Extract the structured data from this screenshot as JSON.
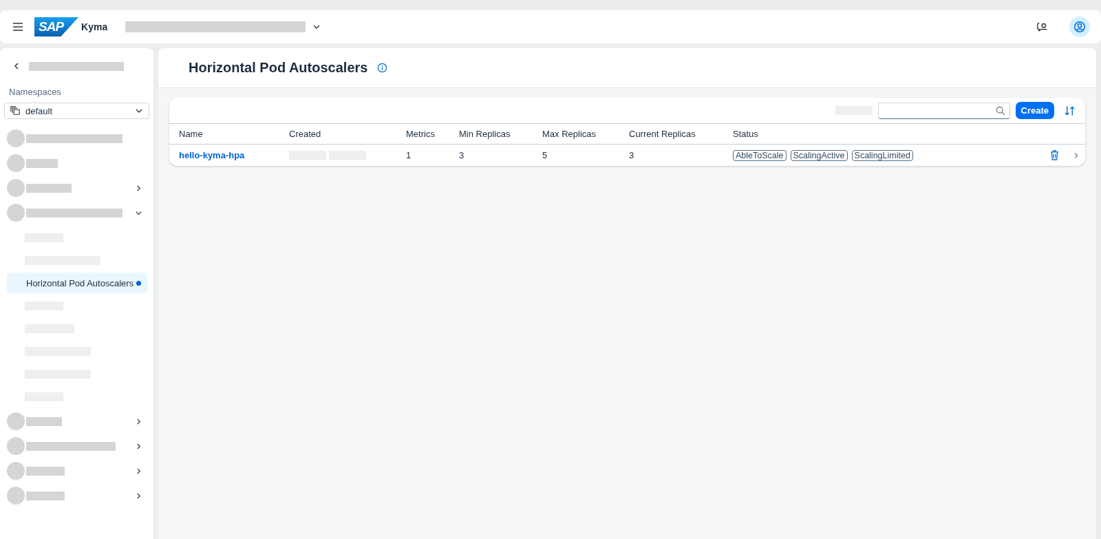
{
  "header": {
    "logo": "SAP",
    "product": "Kyma"
  },
  "sidebar": {
    "namespaces_label": "Namespaces",
    "namespace": "default",
    "items": [
      {
        "kind": "redacted"
      },
      {
        "kind": "redacted"
      },
      {
        "kind": "redacted",
        "expanded": false
      },
      {
        "kind": "redacted",
        "expanded": true,
        "children": [
          {
            "kind": "redacted",
            "selected": false
          },
          {
            "kind": "redacted",
            "selected": false
          },
          {
            "kind": "label",
            "label": "Horizontal Pod Autoscalers",
            "selected": true
          },
          {
            "kind": "redacted",
            "selected": false
          },
          {
            "kind": "redacted",
            "selected": false
          },
          {
            "kind": "redacted",
            "selected": false
          },
          {
            "kind": "redacted",
            "selected": false
          },
          {
            "kind": "redacted",
            "selected": false
          }
        ]
      },
      {
        "kind": "redacted",
        "expanded": false
      },
      {
        "kind": "redacted",
        "expanded": false
      },
      {
        "kind": "redacted",
        "expanded": false
      },
      {
        "kind": "redacted",
        "expanded": false
      }
    ]
  },
  "page": {
    "title": "Horizontal Pod Autoscalers"
  },
  "toolbar": {
    "create": "Create"
  },
  "table": {
    "columns": [
      "Name",
      "Created",
      "Metrics",
      "Min Replicas",
      "Max Replicas",
      "Current Replicas",
      "Status"
    ],
    "rows": [
      {
        "name": "hello-kyma-hpa",
        "metrics": "1",
        "min_replicas": "3",
        "max_replicas": "5",
        "current_replicas": "3",
        "status": [
          "AbleToScale",
          "ScalingActive",
          "ScalingLimited"
        ]
      }
    ]
  }
}
